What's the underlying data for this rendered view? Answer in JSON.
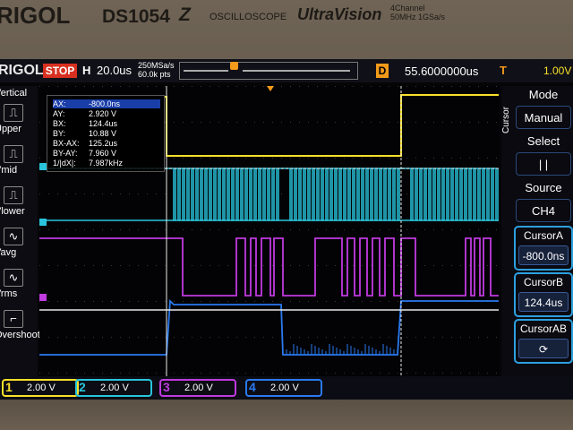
{
  "brand": {
    "logo": "RIGOL",
    "model": "DS1054",
    "model_suffix": "Z",
    "product_line": "OSCILLOSCOPE",
    "series": "UltraVision",
    "channels": "4Channel",
    "bandwidth": "50MHz 1GSa/s"
  },
  "status_bar": {
    "logo": "RIGOL",
    "run_state": "STOP",
    "horizontal_label": "H",
    "timebase": "20.0us",
    "sample_rate": "250MSa/s",
    "memory_points": "60.0k pts",
    "delay_label": "D",
    "delay_value": "55.6000000us",
    "trigger_label": "T",
    "trigger_level": "1.00V",
    "trigger_marker_color": "#f7e02a"
  },
  "left_menu": [
    {
      "label": "Vertical",
      "icon": "vertical-icon"
    },
    {
      "label": "Upper",
      "icon": "pulse-upper-icon"
    },
    {
      "label": "Vmid",
      "icon": "pulse-mid-icon"
    },
    {
      "label": "Vlower",
      "icon": "pulse-lower-icon"
    },
    {
      "label": "Vavg",
      "icon": "sine-avg-icon"
    },
    {
      "label": "Vrms",
      "icon": "sine-rms-icon"
    },
    {
      "label": "Overshoot",
      "icon": "overshoot-icon"
    }
  ],
  "cursor_readout": {
    "rows": [
      {
        "label": "AX:",
        "value": "-800.0ns"
      },
      {
        "label": "AY:",
        "value": "2.920 V"
      },
      {
        "label": "BX:",
        "value": "124.4us"
      },
      {
        "label": "BY:",
        "value": "10.88 V"
      },
      {
        "label": "BX-AX:",
        "value": "125.2us"
      },
      {
        "label": "BY-AY:",
        "value": "7.960 V"
      },
      {
        "label": "1/|dX|:",
        "value": "7.987kHz"
      }
    ]
  },
  "right_menu": {
    "side_label": "Cursor",
    "mode_title": "Mode",
    "mode_value": "Manual",
    "select_title": "Select",
    "select_value": "| |",
    "source_title": "Source",
    "source_value": "CH4",
    "cursor_a_title": "CursorA",
    "cursor_a_value": "-800.0ns",
    "cursor_b_title": "CursorB",
    "cursor_b_value": "124.4us",
    "cursor_ab_title": "CursorAB"
  },
  "channels": [
    {
      "num": "1",
      "scale": "2.00 V",
      "color": "#f7e02a"
    },
    {
      "num": "2",
      "scale": "2.00 V",
      "color": "#29c4dc"
    },
    {
      "num": "3",
      "scale": "2.00 V",
      "color": "#c03ae0"
    },
    {
      "num": "4",
      "scale": "2.00 V",
      "color": "#2a7af0"
    }
  ]
}
